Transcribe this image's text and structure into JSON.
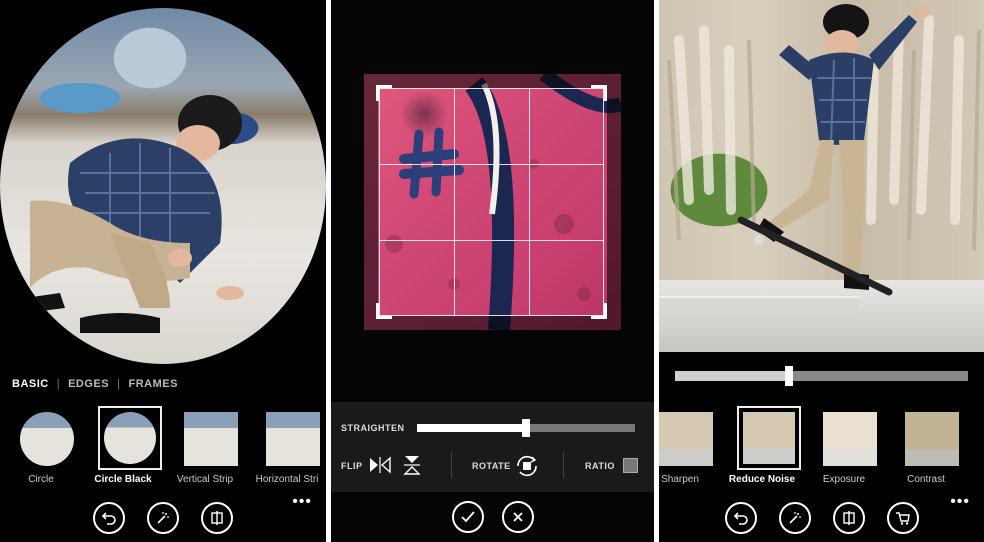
{
  "screen1": {
    "tabs": [
      {
        "label": "BASIC",
        "active": true
      },
      {
        "label": "EDGES",
        "active": false
      },
      {
        "label": "FRAMES",
        "active": false
      }
    ],
    "tab_separator": "|",
    "thumbs": [
      {
        "label": "Circle",
        "selected": false
      },
      {
        "label": "Circle Black",
        "selected": true
      },
      {
        "label": "Vertical Strip",
        "selected": false
      },
      {
        "label": "Horizontal Stri",
        "selected": false
      }
    ],
    "appbar": [
      {
        "icon": "undo-icon"
      },
      {
        "icon": "magic-wand-icon"
      },
      {
        "icon": "compare-icon"
      }
    ],
    "more": "•••"
  },
  "screen2": {
    "straighten_label": "STRAIGHTEN",
    "straighten_value": 0.5,
    "flip_label": "FLIP",
    "rotate_label": "ROTATE",
    "ratio_label": "RATIO",
    "confirm_icon": "check-icon",
    "cancel_icon": "close-icon"
  },
  "screen3": {
    "slider_value": 0.39,
    "thumbs": [
      {
        "label": "Sharpen",
        "selected": false
      },
      {
        "label": "Reduce Noise",
        "selected": true
      },
      {
        "label": "Exposure",
        "selected": false
      },
      {
        "label": "Contrast",
        "selected": false
      }
    ],
    "appbar": [
      {
        "icon": "undo-icon"
      },
      {
        "icon": "magic-wand-icon"
      },
      {
        "icon": "compare-icon"
      },
      {
        "icon": "cart-icon"
      }
    ],
    "more": "•••"
  }
}
